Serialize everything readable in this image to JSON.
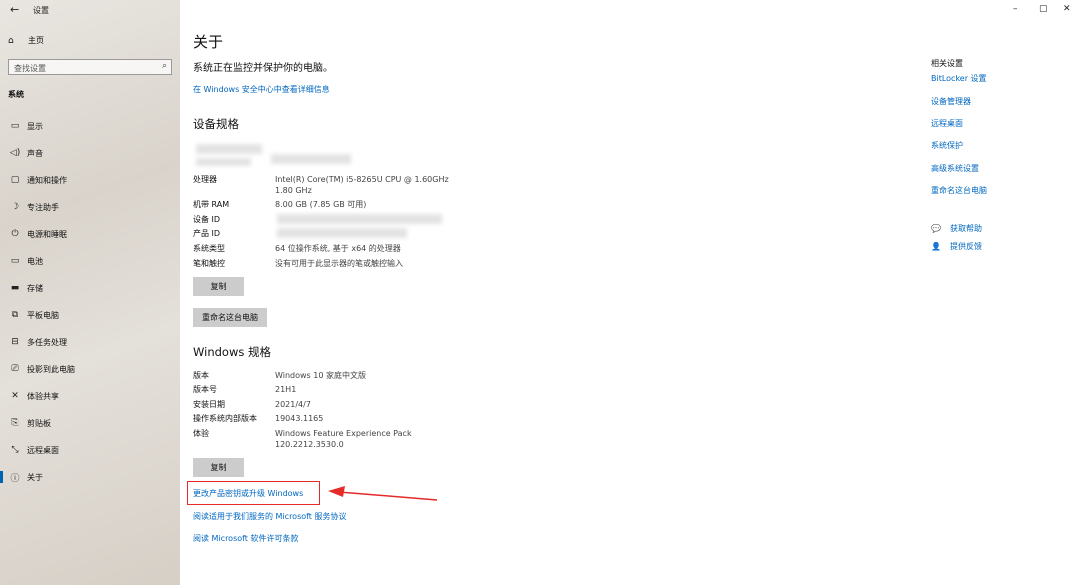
{
  "window": {
    "title": "设置",
    "back_glyph": "←",
    "controls": {
      "minimize": "–",
      "maximize": "▢",
      "close": "✕"
    }
  },
  "sidebar": {
    "home": "主页",
    "search_placeholder": "查找设置",
    "section": "系统",
    "items": [
      {
        "label": "显示",
        "icon": "monitor-icon"
      },
      {
        "label": "声音",
        "icon": "speaker-icon"
      },
      {
        "label": "通知和操作",
        "icon": "notification-icon"
      },
      {
        "label": "专注助手",
        "icon": "moon-icon"
      },
      {
        "label": "电源和睡眠",
        "icon": "power-icon"
      },
      {
        "label": "电池",
        "icon": "battery-icon"
      },
      {
        "label": "存储",
        "icon": "storage-icon"
      },
      {
        "label": "平板电脑",
        "icon": "tablet-icon"
      },
      {
        "label": "多任务处理",
        "icon": "multitask-icon"
      },
      {
        "label": "投影到此电脑",
        "icon": "project-icon"
      },
      {
        "label": "体验共享",
        "icon": "share-icon"
      },
      {
        "label": "剪贴板",
        "icon": "clipboard-icon"
      },
      {
        "label": "远程桌面",
        "icon": "remote-icon"
      },
      {
        "label": "关于",
        "icon": "info-icon"
      }
    ]
  },
  "main": {
    "title": "关于",
    "status": "系统正在监控并保护你的电脑。",
    "security_link": "在 Windows 安全中心中查看详细信息",
    "device_specs": {
      "heading": "设备规格",
      "rows": [
        {
          "key": "处理器",
          "value": "Intel(R) Core(TM) i5-8265U CPU @ 1.60GHz",
          "value2": "1.80 GHz"
        },
        {
          "key": "机带 RAM",
          "value": "8.00 GB (7.85 GB 可用)"
        },
        {
          "key": "设备 ID",
          "value": ""
        },
        {
          "key": "产品 ID",
          "value": ""
        },
        {
          "key": "系统类型",
          "value": "64 位操作系统, 基于 x64 的处理器"
        },
        {
          "key": "笔和触控",
          "value": "没有可用于此显示器的笔或触控输入"
        }
      ],
      "copy_button": "复制",
      "rename_button": "重命名这台电脑"
    },
    "windows_specs": {
      "heading": "Windows 规格",
      "rows": [
        {
          "key": "版本",
          "value": "Windows 10 家庭中文版"
        },
        {
          "key": "版本号",
          "value": "21H1"
        },
        {
          "key": "安装日期",
          "value": "2021/4/7"
        },
        {
          "key": "操作系统内部版本",
          "value": "19043.1165"
        },
        {
          "key": "体验",
          "value": "Windows Feature Experience Pack",
          "value2": "120.2212.3530.0"
        }
      ],
      "copy_button": "复制"
    },
    "links": [
      "更改产品密钥或升级 Windows",
      "阅读适用于我们服务的 Microsoft 服务协议",
      "阅读 Microsoft 软件许可条款"
    ]
  },
  "related": {
    "title": "相关设置",
    "links": [
      "BitLocker 设置",
      "设备管理器",
      "远程桌面",
      "系统保护",
      "高级系统设置",
      "重命名这台电脑"
    ],
    "help": "获取帮助",
    "feedback": "提供反馈"
  },
  "colors": {
    "accent": "#0067c0",
    "highlight": "#e52a2a"
  }
}
